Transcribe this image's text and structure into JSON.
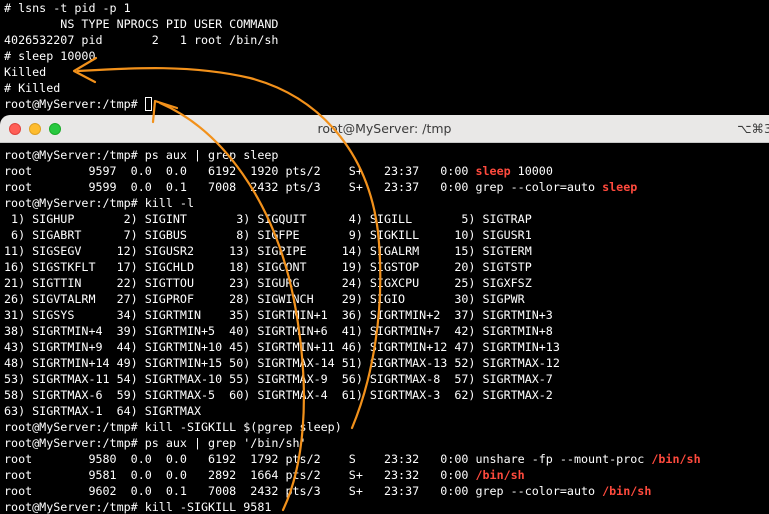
{
  "colors": {
    "highlight": "#ff4a3d",
    "annotation": "#f2911b",
    "traffic_close": "#ff5f57",
    "traffic_minimize": "#febc2e",
    "traffic_zoom": "#28c840"
  },
  "back_terminal": {
    "lines": [
      "# lsns -t pid -p 1",
      "        NS TYPE NPROCS PID USER COMMAND",
      "4026532207 pid       2   1 root /bin/sh",
      "# sleep 10000",
      "Killed",
      "# Killed",
      "root@MyServer:/tmp# "
    ]
  },
  "front_window": {
    "title": "root@MyServer: /tmp",
    "shortcut": "⌥⌘3",
    "lines": [
      [
        {
          "t": "root@MyServer:/tmp# ps aux | grep sleep"
        }
      ],
      [
        {
          "t": "root        9597  0.0  0.0   6192  1920 pts/2    S+   23:37   0:00 "
        },
        {
          "t": "sleep",
          "hl": true
        },
        {
          "t": " 10000"
        }
      ],
      [
        {
          "t": "root        9599  0.0  0.1   7008  2432 pts/3    S+   23:37   0:00 grep --color=auto "
        },
        {
          "t": "sleep",
          "hl": true
        }
      ],
      [
        {
          "t": "root@MyServer:/tmp# kill -l"
        }
      ],
      [
        {
          "t": " 1) SIGHUP       2) SIGINT       3) SIGQUIT      4) SIGILL       5) SIGTRAP"
        }
      ],
      [
        {
          "t": " 6) SIGABRT      7) SIGBUS       8) SIGFPE       9) SIGKILL     10) SIGUSR1"
        }
      ],
      [
        {
          "t": "11) SIGSEGV     12) SIGUSR2     13) SIGPIPE     14) SIGALRM     15) SIGTERM"
        }
      ],
      [
        {
          "t": "16) SIGSTKFLT   17) SIGCHLD     18) SIGCONT     19) SIGSTOP     20) SIGTSTP"
        }
      ],
      [
        {
          "t": "21) SIGTTIN     22) SIGTTOU     23) SIGURG      24) SIGXCPU     25) SIGXFSZ"
        }
      ],
      [
        {
          "t": "26) SIGVTALRM   27) SIGPROF     28) SIGWINCH    29) SIGIO       30) SIGPWR"
        }
      ],
      [
        {
          "t": "31) SIGSYS      34) SIGRTMIN    35) SIGRTMIN+1  36) SIGRTMIN+2  37) SIGRTMIN+3"
        }
      ],
      [
        {
          "t": "38) SIGRTMIN+4  39) SIGRTMIN+5  40) SIGRTMIN+6  41) SIGRTMIN+7  42) SIGRTMIN+8"
        }
      ],
      [
        {
          "t": "43) SIGRTMIN+9  44) SIGRTMIN+10 45) SIGRTMIN+11 46) SIGRTMIN+12 47) SIGRTMIN+13"
        }
      ],
      [
        {
          "t": "48) SIGRTMIN+14 49) SIGRTMIN+15 50) SIGRTMAX-14 51) SIGRTMAX-13 52) SIGRTMAX-12"
        }
      ],
      [
        {
          "t": "53) SIGRTMAX-11 54) SIGRTMAX-10 55) SIGRTMAX-9  56) SIGRTMAX-8  57) SIGRTMAX-7"
        }
      ],
      [
        {
          "t": "58) SIGRTMAX-6  59) SIGRTMAX-5  60) SIGRTMAX-4  61) SIGRTMAX-3  62) SIGRTMAX-2"
        }
      ],
      [
        {
          "t": "63) SIGRTMAX-1  64) SIGRTMAX"
        }
      ],
      [
        {
          "t": "root@MyServer:/tmp# kill -SIGKILL $(pgrep sleep)"
        }
      ],
      [
        {
          "t": "root@MyServer:/tmp# ps aux | grep '/bin/sh'"
        }
      ],
      [
        {
          "t": "root        9580  0.0  0.0   6192  1792 pts/2    S    23:32   0:00 unshare -fp --mount-proc "
        },
        {
          "t": "/bin/sh",
          "hl": true
        }
      ],
      [
        {
          "t": "root        9581  0.0  0.0   2892  1664 pts/2    S+   23:32   0:00 "
        },
        {
          "t": "/bin/sh",
          "hl": true
        }
      ],
      [
        {
          "t": "root        9602  0.0  0.1   7008  2432 pts/3    S+   23:37   0:00 grep --color=auto "
        },
        {
          "t": "/bin/sh",
          "hl": true
        }
      ],
      [
        {
          "t": "root@MyServer:/tmp# kill -SIGKILL 9581"
        }
      ]
    ]
  }
}
